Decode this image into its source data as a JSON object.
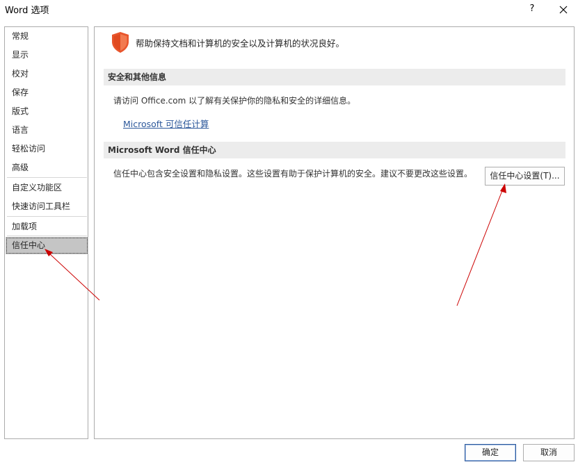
{
  "window": {
    "title": "Word 选项",
    "help_glyph": "?",
    "close_icon": "close-icon"
  },
  "sidebar": {
    "items": [
      {
        "label": "常规"
      },
      {
        "label": "显示"
      },
      {
        "label": "校对"
      },
      {
        "label": "保存"
      },
      {
        "label": "版式"
      },
      {
        "label": "语言"
      },
      {
        "label": "轻松访问"
      },
      {
        "label": "高级"
      },
      {
        "label": "自定义功能区"
      },
      {
        "label": "快速访问工具栏"
      },
      {
        "label": "加载项"
      },
      {
        "label": "信任中心",
        "selected": true
      }
    ]
  },
  "main": {
    "header_icon": "shield-icon",
    "header_text": "帮助保持文档和计算机的安全以及计算机的状况良好。",
    "section1": {
      "title": "安全和其他信息",
      "text": "请访问 Office.com  以了解有关保护你的隐私和安全的详细信息。",
      "link": "Microsoft 可信任计算"
    },
    "section2": {
      "title": "Microsoft Word 信任中心",
      "text": "信任中心包含安全设置和隐私设置。这些设置有助于保护计算机的安全。建议不要更改这些设置。",
      "button_label": "信任中心设置(T)..."
    }
  },
  "footer": {
    "ok_label": "确定",
    "cancel_label": "取消"
  },
  "colors": {
    "accent": "#2b579a",
    "shield": "#e8552c",
    "annotation_arrow": "#cc0000",
    "selected_bg": "#c5c5c5",
    "section_bg": "#ececec"
  }
}
